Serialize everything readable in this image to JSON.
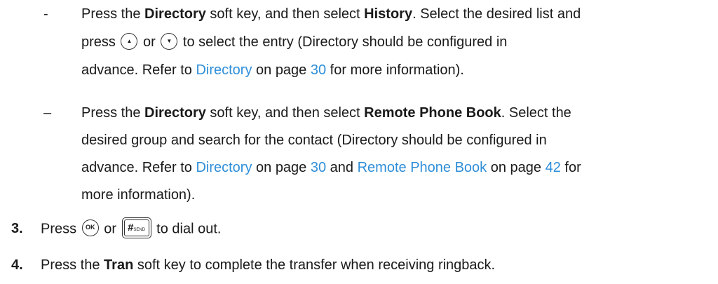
{
  "b1": {
    "bullet": "-",
    "l1": {
      "t1": "Press the ",
      "b1": "Directory",
      "t2": " soft key, and then select ",
      "b2": "History",
      "t3": ". Select the desired list and"
    },
    "l2": {
      "t1": "press ",
      "t2": " or ",
      "t3": " to select the entry (Directory should be configured in"
    },
    "l3": {
      "t1": "advance. Refer to ",
      "link": "Directory",
      "t2": " on page ",
      "page": "30",
      "t3": " for more information)."
    }
  },
  "b2": {
    "bullet": "–",
    "l1": {
      "t1": "Press the ",
      "b1": "Directory",
      "t2": " soft key, and then select ",
      "b2": "Remote Phone Book",
      "t3": ". Select the"
    },
    "l2": {
      "t1": "desired group and search for the contact (Directory should be configured in"
    },
    "l3": {
      "t1": "advance. Refer to ",
      "link1": "Directory",
      "t2": " on page ",
      "page1": "30",
      "t3": " and ",
      "link2": "Remote Phone Book",
      "t4": " on page ",
      "page2": "42",
      "t5": " for"
    },
    "l4": {
      "t1": "more information)."
    }
  },
  "step3": {
    "num": "3.",
    "t1": "Press ",
    "ok_label": "OK",
    "t2": " or ",
    "hash_label": "#",
    "send_label": "SEND",
    "t3": " to dial out."
  },
  "step4": {
    "num": "4.",
    "t1": "Press the ",
    "b1": "Tran",
    "t2": " soft key to complete the transfer when receiving ringback."
  },
  "icons": {
    "up": "up-arrow-key-icon",
    "down": "down-arrow-key-icon",
    "ok": "ok-key-icon",
    "send": "hash-send-key-icon"
  }
}
